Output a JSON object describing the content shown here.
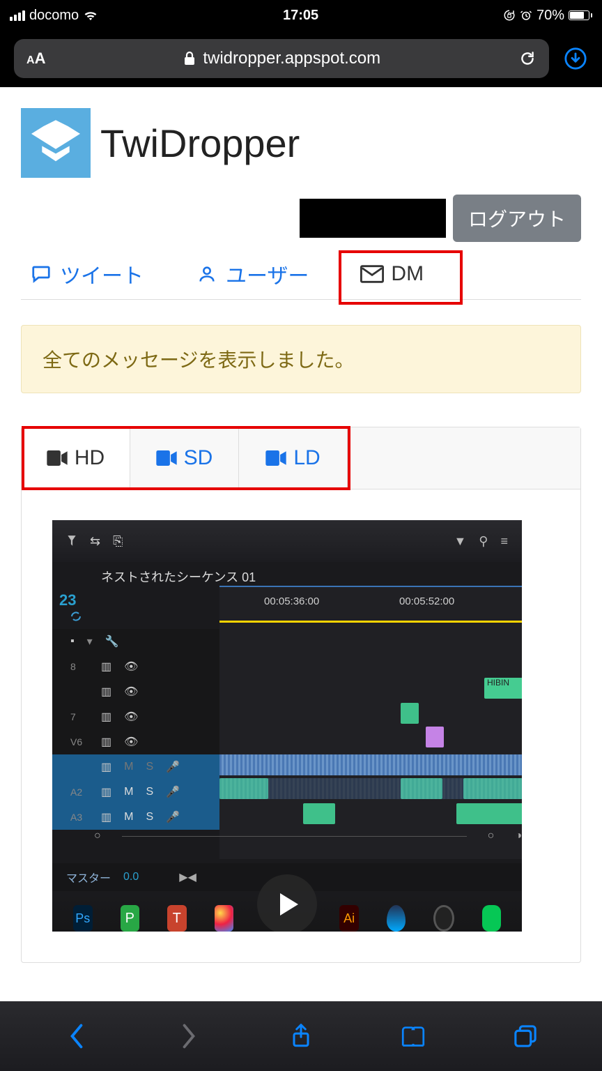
{
  "status": {
    "carrier": "docomo",
    "time": "17:05",
    "battery_pct": "70%"
  },
  "browser": {
    "url_display": "twidropper.appspot.com"
  },
  "brand": {
    "title": "TwiDropper"
  },
  "header": {
    "logout": "ログアウト"
  },
  "tabs": {
    "tweet": "ツイート",
    "user": "ユーザー",
    "dm": "DM"
  },
  "alert": {
    "message": "全てのメッセージを表示しました。"
  },
  "quality": {
    "hd": "HD",
    "sd": "SD",
    "ld": "LD"
  },
  "thumb": {
    "sequence_title": "ネストされたシーケンス 01",
    "tc_left": "23",
    "tc1": "00:05:36:00",
    "tc2": "00:05:52:00",
    "master_label": "マスター",
    "master_val": "0.0",
    "clip_label": "HIBIN",
    "track_labels": {
      "v8": "8",
      "v7": "7",
      "v6": "V6",
      "a2": "A2",
      "a3": "A3"
    }
  }
}
